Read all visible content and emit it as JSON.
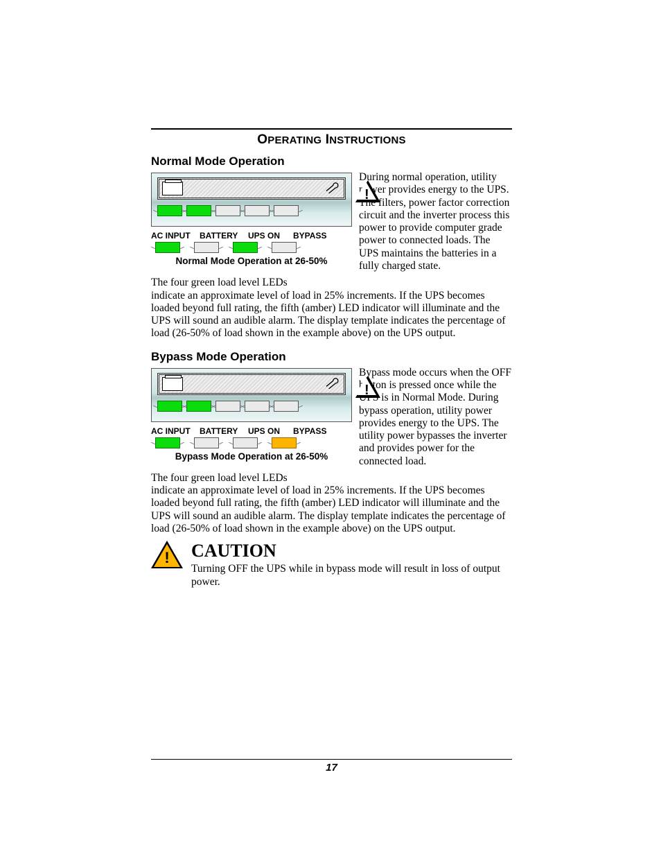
{
  "page_title": {
    "big1": "O",
    "small1": "PERATING",
    "gap": " ",
    "big2": "I",
    "small2": "NSTRUCTIONS"
  },
  "sections": {
    "normal": {
      "heading": "Normal Mode Operation",
      "figure": {
        "status_labels": [
          "AC INPUT",
          "BATTERY",
          "UPS ON",
          "BYPASS"
        ],
        "status_leds": [
          "green",
          "off",
          "green",
          "off"
        ],
        "load_leds": [
          "green",
          "green",
          "off",
          "off",
          "off"
        ],
        "caption": "Normal Mode Operation at 26-50%"
      },
      "side_text": "During normal operation, utility power provides energy to the UPS. The filters, power factor correction circuit and the inverter process this power to provide computer grade power to connected loads. The UPS maintains the batteries in a fully charged state.",
      "lead_in": "The four green load level LEDs",
      "after_text": "indicate an approximate level of load in 25% increments. If the UPS becomes loaded beyond full rating, the fifth (amber) LED indicator will illuminate and the UPS will sound an audible alarm. The display template indicates the percentage of load (26-50% of load shown in the example above) on the UPS output."
    },
    "bypass": {
      "heading": "Bypass Mode Operation",
      "figure": {
        "status_labels": [
          "AC INPUT",
          "BATTERY",
          "UPS ON",
          "BYPASS"
        ],
        "status_leds": [
          "green",
          "off",
          "off",
          "amber"
        ],
        "load_leds": [
          "green",
          "green",
          "off",
          "off",
          "off"
        ],
        "caption": "Bypass Mode Operation at 26-50%"
      },
      "side_text": "Bypass mode occurs when the OFF button is pressed once while the UPS is in Normal Mode. During bypass operation, utility power provides energy to the UPS. The utility power bypasses the inverter and provides power for the connected load.",
      "lead_in": "The four green load level LEDs",
      "after_text": "indicate an approximate level of load in 25% increments. If the UPS becomes loaded beyond full rating, the fifth (amber) LED indicator will illuminate and the UPS will sound an audible alarm. The display template indicates the percentage of load (26-50% of load shown in the example above) on the UPS output."
    }
  },
  "caution": {
    "title": "CAUTION",
    "text": "Turning OFF the UPS while in bypass mode will result in loss of output power."
  },
  "page_number": "17"
}
